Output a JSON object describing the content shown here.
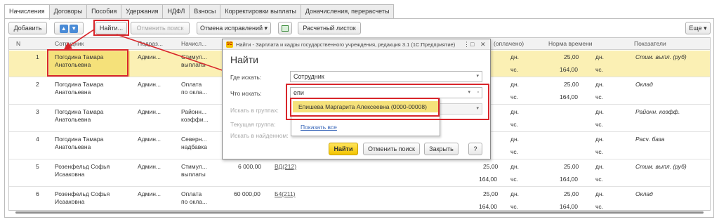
{
  "tabs": [
    "Начисления",
    "Договоры",
    "Пособия",
    "Удержания",
    "НДФЛ",
    "Взносы",
    "Корректировки выплаты",
    "Доначисления, перерасчеты"
  ],
  "toolbar": {
    "add_label": "Добавить",
    "up_arrow": "▲",
    "down_arrow": "▼",
    "find_label": "Найти...",
    "cancel_search_label": "Отменить поиск",
    "cancel_corrections_label": "Отмена исправлений",
    "cancel_corrections_arrow": "▾",
    "payslip_label": "Расчетный листок",
    "more_label": "Еще",
    "more_arrow": "▾"
  },
  "grid": {
    "headers": {
      "n": "N",
      "employee": "Сотрудник",
      "dept": "Подраз...",
      "accrual": "Начисл...",
      "paid": "(оплачено)",
      "norm": "Норма времени",
      "indicators": "Показатели"
    },
    "rows": [
      {
        "n": "1",
        "emp1": "Погодина Тамара",
        "emp2": "Анатольевна",
        "dept": "Админ...",
        "acc1": "Стимул...",
        "acc2": "выплаты",
        "sum": "",
        "code": "",
        "v1": "",
        "u1": "дн.",
        "v2": "",
        "u2": "чс.",
        "n1": "25,00",
        "nu1": "дн.",
        "n2": "164,00",
        "nu2": "чс.",
        "ind": "Стим. выпл. (руб)"
      },
      {
        "n": "2",
        "emp1": "Погодина Тамара",
        "emp2": "Анатольевна",
        "dept": "Админ...",
        "acc1": "Оплата",
        "acc2": "по окла...",
        "sum": "",
        "code": "",
        "v1": "",
        "u1": "дн.",
        "v2": "",
        "u2": "чс.",
        "n1": "25,00",
        "nu1": "дн.",
        "n2": "164,00",
        "nu2": "чс.",
        "ind": "Оклад"
      },
      {
        "n": "3",
        "emp1": "Погодина Тамара",
        "emp2": "Анатольевна",
        "dept": "Админ...",
        "acc1": "Районн...",
        "acc2": "коэффи...",
        "sum": "",
        "code": "",
        "v1": "",
        "u1": "дн.",
        "v2": "",
        "u2": "чс.",
        "n1": "",
        "nu1": "дн.",
        "n2": "",
        "nu2": "чс.",
        "ind": "Районн. коэфф."
      },
      {
        "n": "4",
        "emp1": "Погодина Тамара",
        "emp2": "Анатольевна",
        "dept": "Админ...",
        "acc1": "Северн...",
        "acc2": "надбавка",
        "sum": "",
        "code": "",
        "v1": "",
        "u1": "дн.",
        "v2": "",
        "u2": "чс.",
        "n1": "",
        "nu1": "дн.",
        "n2": "",
        "nu2": "чс.",
        "ind": "Расч. база"
      },
      {
        "n": "5",
        "emp1": "Розенфельд Софья",
        "emp2": "Исааковна",
        "dept": "Админ...",
        "acc1": "Стимул...",
        "acc2": "выплаты",
        "sum": "6 000,00",
        "code": "ВД(212)",
        "v1": "25,00",
        "u1": "дн.",
        "v2": "164,00",
        "u2": "чс.",
        "n1": "25,00",
        "nu1": "дн.",
        "n2": "164,00",
        "nu2": "чс.",
        "ind": "Стим. выпл. (руб)"
      },
      {
        "n": "6",
        "emp1": "Розенфельд Софья",
        "emp2": "Исааковна",
        "dept": "Админ...",
        "acc1": "Оплата",
        "acc2": "по окла...",
        "sum": "60 000,00",
        "code": "Б4(211)",
        "v1": "25,00",
        "u1": "дн.",
        "v2": "164,00",
        "u2": "чс.",
        "n1": "25,00",
        "nu1": "дн.",
        "n2": "164,00",
        "nu2": "чс.",
        "ind": "Оклад"
      }
    ]
  },
  "dialog": {
    "title": "Найти - Зарплата и кадры государственного учреждения, редакция 3.1  (1С:Предприятие)",
    "logo": "1С",
    "ctl_more": "⋮",
    "ctl_max": "□",
    "ctl_close": "✕",
    "heading": "Найти",
    "where_label": "Где искать:",
    "where_value": "Сотрудник",
    "what_label": "Что искать:",
    "what_value": "епи",
    "groups_label": "Искать в группах:",
    "current_group_label": "Текущая группа:",
    "in_found_label": "Искать в найденном:",
    "dropdown_arrow": "▾",
    "clear_icon": "▫",
    "suggestion": "Епишева Маргарита Алексеевна (0000-00008)",
    "show_all": "Показать все",
    "find_button": "Найти",
    "cancel_search_button": "Отменить поиск",
    "close_button": "Закрыть",
    "help_button": "?"
  },
  "colors": {
    "selection": "#fbf0b4",
    "highlight": "#f5e17a",
    "annotation_red": "#d8262b",
    "link": "#3866b8"
  }
}
